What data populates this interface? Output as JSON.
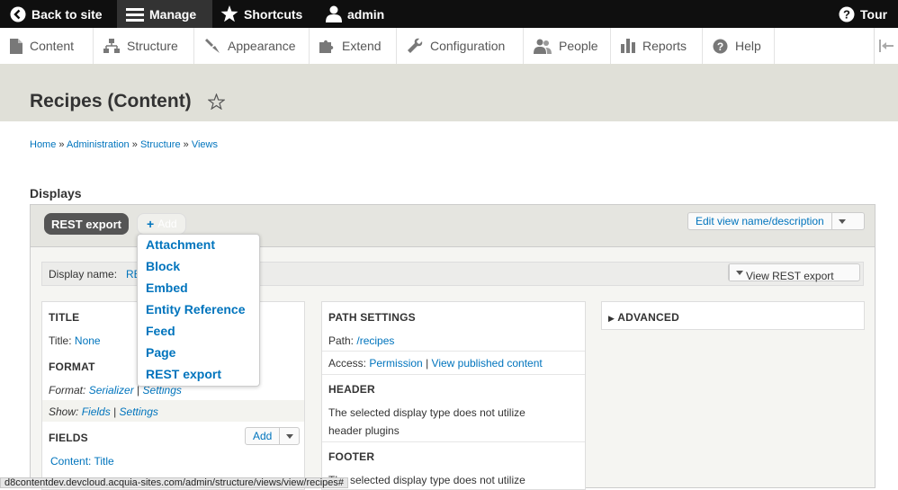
{
  "toolbar": {
    "back": "Back to site",
    "manage": "Manage",
    "shortcuts": "Shortcuts",
    "user": "admin",
    "tour": "Tour"
  },
  "tray": {
    "content": "Content",
    "structure": "Structure",
    "appearance": "Appearance",
    "extend": "Extend",
    "configuration": "Configuration",
    "people": "People",
    "reports": "Reports",
    "help": "Help"
  },
  "page": {
    "title": "Recipes (Content)"
  },
  "breadcrumb": {
    "home": "Home",
    "administration": "Administration",
    "structure": "Structure",
    "views": "Views",
    "sep": "»"
  },
  "displays": {
    "heading": "Displays",
    "active_tab": "REST export",
    "add_label": "Add",
    "edit_button": "Edit view name/description",
    "display_name_label": "Display name:",
    "display_name_value": "RE",
    "view_button": "View REST export"
  },
  "dropdown": {
    "options": [
      "Attachment",
      "Block",
      "Embed",
      "Entity Reference",
      "Feed",
      "Page",
      "REST export"
    ]
  },
  "left_col": {
    "title_heading": "TITLE",
    "title_label": "Title:",
    "title_value": "None",
    "format_heading": "FORMAT",
    "format_label": "Format:",
    "format_value": "Serializer",
    "format_settings": "Settings",
    "show_label": "Show:",
    "show_value": "Fields",
    "show_settings": "Settings",
    "fields_heading": "FIELDS",
    "fields_add": "Add",
    "field_1": "Content: Title",
    "pipe": "|"
  },
  "mid_col": {
    "path_heading": "PATH SETTINGS",
    "path_label": "Path:",
    "path_value": "/recipes",
    "access_label": "Access:",
    "access_value": "Permission",
    "access_link": "View published content",
    "header_heading": "HEADER",
    "header_text_1": "The selected display type does not utilize",
    "header_text_2": "header plugins",
    "footer_heading": "FOOTER",
    "footer_text_1": "The selected display type does not utilize",
    "pipe": "|"
  },
  "right_col": {
    "advanced": "ADVANCED",
    "arrow": "▶"
  },
  "status_url": "d8contentdev.devcloud.acquia-sites.com/admin/structure/views/view/recipes#"
}
